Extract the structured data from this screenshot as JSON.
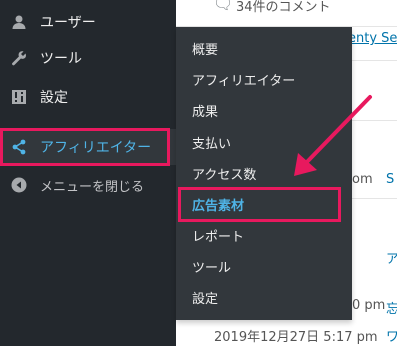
{
  "sidebar": {
    "items": [
      {
        "label": "ユーザー",
        "icon": "user-icon"
      },
      {
        "label": "ツール",
        "icon": "wrench-icon"
      },
      {
        "label": "設定",
        "icon": "settings-icon"
      },
      {
        "label": "アフィリエイター",
        "icon": "share-icon",
        "active": true
      },
      {
        "label": "メニューを閉じる",
        "icon": "collapse-icon"
      }
    ]
  },
  "submenu": {
    "items": [
      {
        "label": "概要"
      },
      {
        "label": "アフィリエイター"
      },
      {
        "label": "成果"
      },
      {
        "label": "支払い"
      },
      {
        "label": "アクセス数"
      },
      {
        "label": "広告素材",
        "current": true
      },
      {
        "label": "レポート"
      },
      {
        "label": "ツール"
      },
      {
        "label": "設定"
      }
    ]
  },
  "content": {
    "comments_link": "34件のコメント",
    "theme_link_fragment": "enty Se",
    "time_fragment_1": "om",
    "link_fragment_1": "S",
    "link_fragment_2": "ア",
    "time_fragment_2": "0 pm",
    "link_fragment_3": "忘",
    "date_line": "2019年12月27日 5:17 pm",
    "link_fragment_4": "ワ"
  },
  "colors": {
    "sidebar_bg": "#23282d",
    "submenu_bg": "#32373c",
    "active_text": "#4fb3e6",
    "highlight": "#e8195e",
    "link": "#0073aa"
  }
}
